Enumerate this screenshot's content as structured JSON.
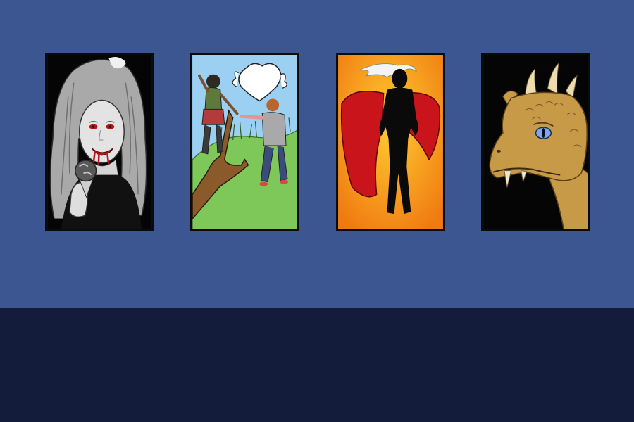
{
  "scene": {
    "wall_color": "#3b5690",
    "floor_color": "#141c3c",
    "frame_border_color": "#0b0b0b"
  },
  "paintings": [
    {
      "subject": "vampire-portrait",
      "icon": "vampire-woman-icon",
      "background": "#050505"
    },
    {
      "subject": "couple-on-tree-heart-cloud",
      "icon": "couple-icon",
      "background": "#9bd0f2"
    },
    {
      "subject": "caped-hero-silhouette",
      "icon": "superhero-icon",
      "background": "#f2901c"
    },
    {
      "subject": "dragon-head",
      "icon": "dragon-icon",
      "background": "#050505"
    }
  ]
}
